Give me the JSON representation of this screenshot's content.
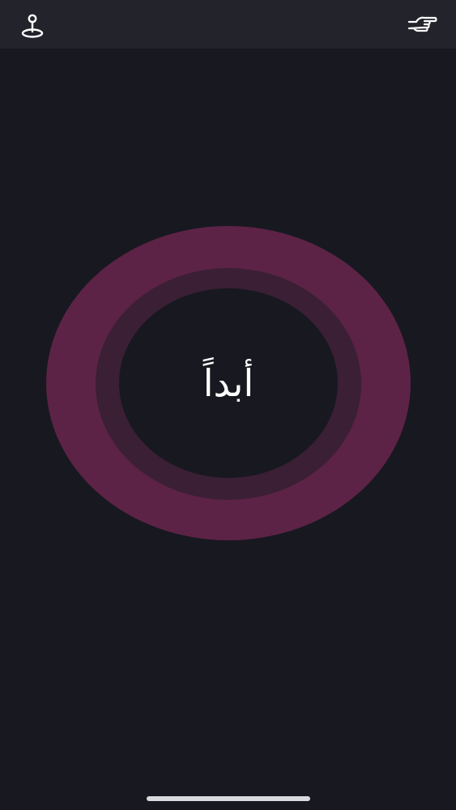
{
  "top_bar": {
    "left_icon": "joystick-icon",
    "right_icon": "pointing-hand-icon"
  },
  "main": {
    "word": "أبداً"
  },
  "colors": {
    "background": "#181820",
    "top_bar": "#23232b",
    "ring_outer": "#5c2346",
    "ring_mid": "#3a1f35",
    "ring_inner": "#181820",
    "text": "#ffffff",
    "icon": "#ffffff"
  }
}
